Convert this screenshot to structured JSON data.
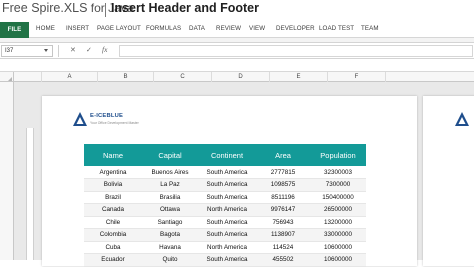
{
  "app": {
    "logo_prefix": "Free ",
    "logo_brand": "Spire.XLS",
    "logo_suffix": " for Java",
    "document_title": "Insert Header and Footer"
  },
  "ribbon": {
    "tabs": [
      "FILE",
      "HOME",
      "INSERT",
      "PAGE LAYOUT",
      "FORMULAS",
      "DATA",
      "REVIEW",
      "VIEW",
      "DEVELOPER",
      "LOAD TEST",
      "TEAM"
    ]
  },
  "formula_bar": {
    "name_box": "I37",
    "cancel_icon": "✕",
    "enter_icon": "✓",
    "function_icon": "fx",
    "formula_value": ""
  },
  "columns": [
    "A",
    "B",
    "C",
    "D",
    "E",
    "F"
  ],
  "header": {
    "brand": "E-ICEBLUE",
    "tagline": "Your Office Development Master",
    "brand_color": "#1f4e8c"
  },
  "table": {
    "header_color": "#139a98",
    "columns": [
      "Name",
      "Capital",
      "Continent",
      "Area",
      "Population"
    ],
    "rows": [
      [
        "Argentina",
        "Buenos Aires",
        "South America",
        "2777815",
        "32300003"
      ],
      [
        "Bolivia",
        "La Paz",
        "South America",
        "1098575",
        "7300000"
      ],
      [
        "Brazil",
        "Brasilia",
        "South America",
        "8511196",
        "150400000"
      ],
      [
        "Canada",
        "Ottawa",
        "North America",
        "9976147",
        "26500000"
      ],
      [
        "Chile",
        "Santiago",
        "South America",
        "756943",
        "13200000"
      ],
      [
        "Colombia",
        "Bagota",
        "South America",
        "1138907",
        "33000000"
      ],
      [
        "Cuba",
        "Havana",
        "North America",
        "114524",
        "10600000"
      ],
      [
        "Ecuador",
        "Quito",
        "South America",
        "455502",
        "10600000"
      ]
    ]
  }
}
